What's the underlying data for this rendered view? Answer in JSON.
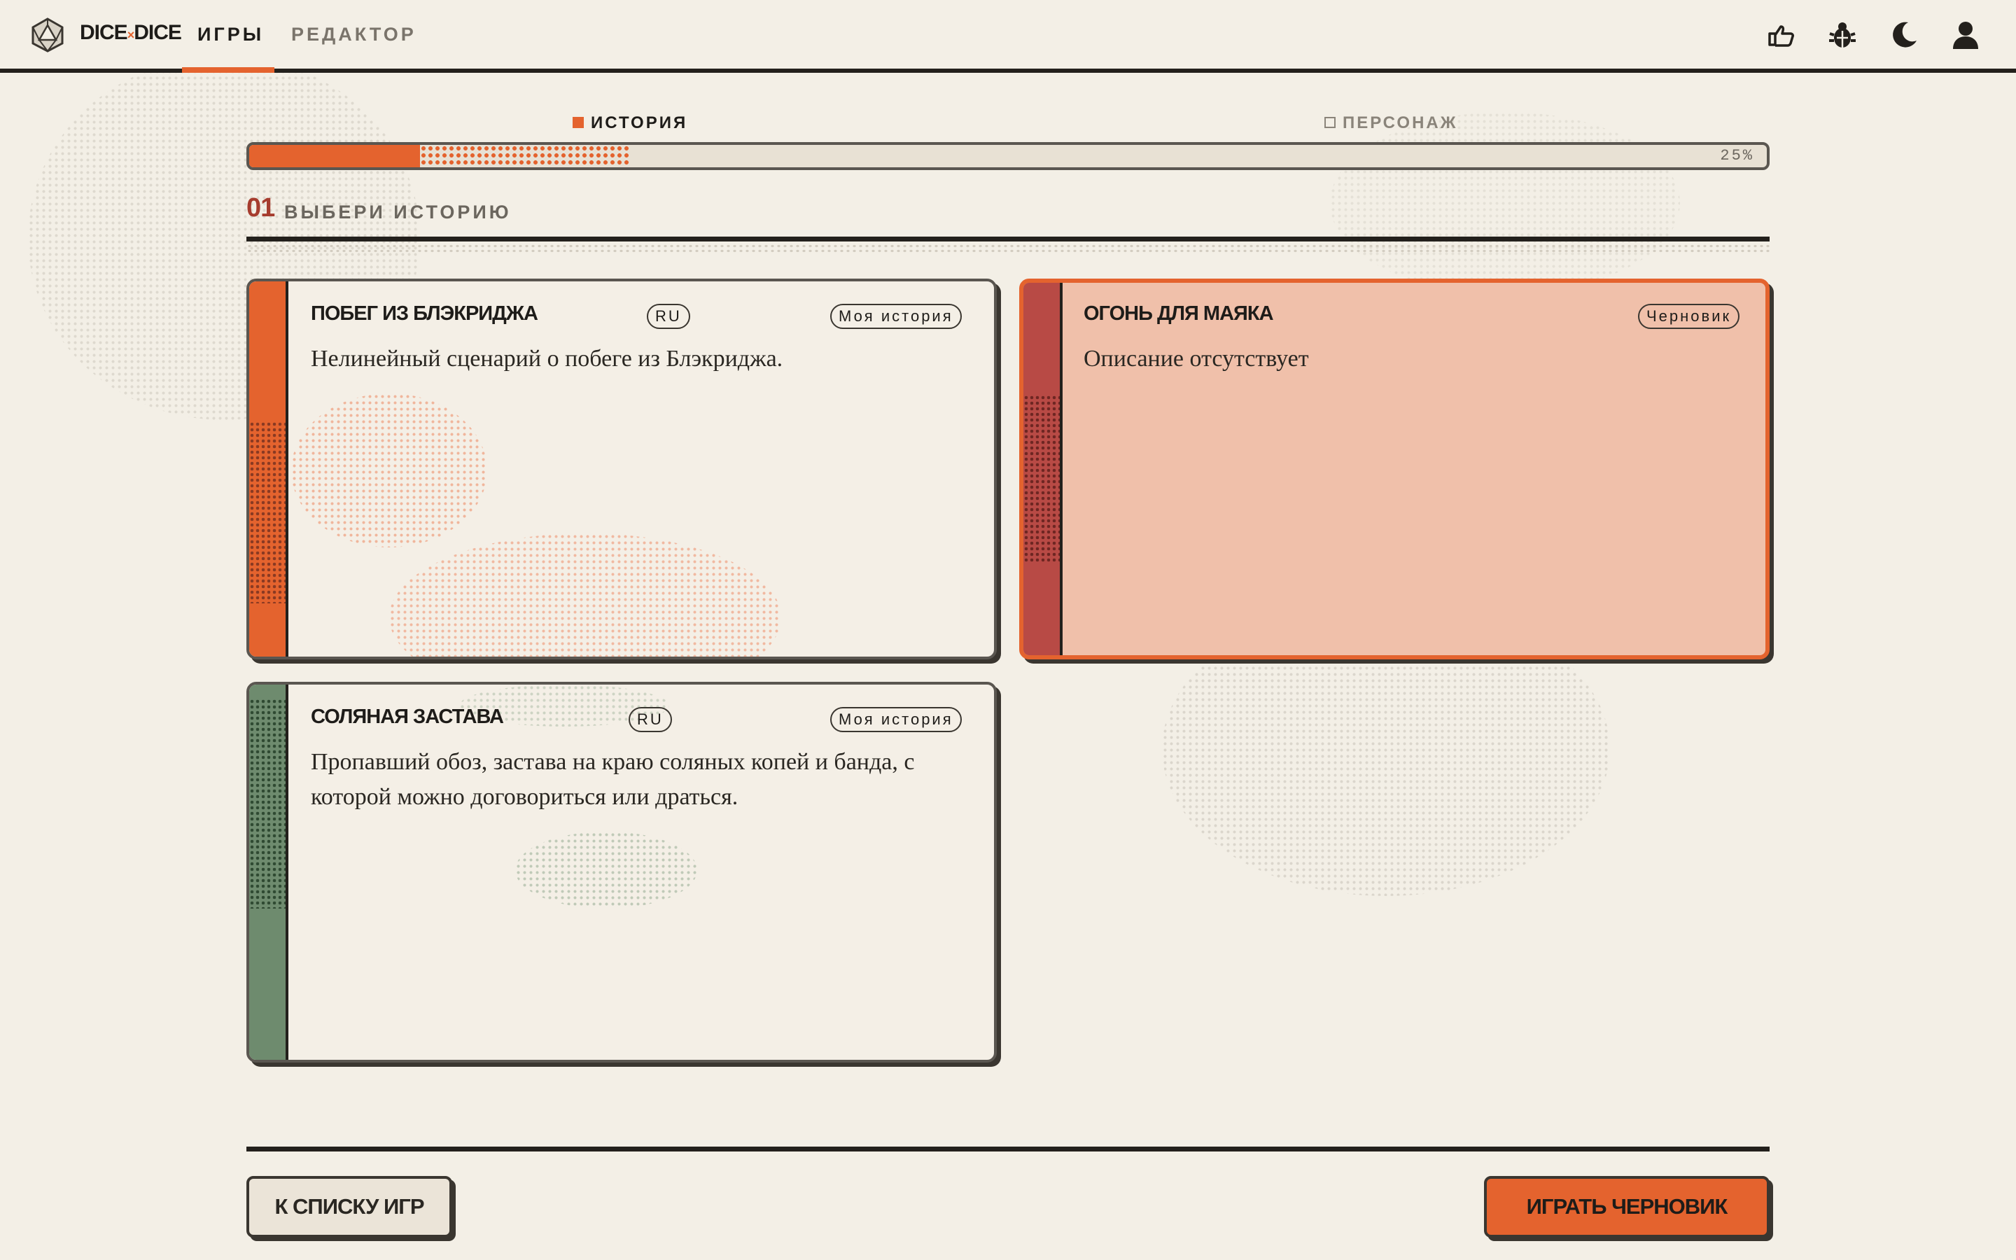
{
  "header": {
    "brand": {
      "left": "DICE",
      "sep": "×",
      "right": "DICE"
    },
    "nav": [
      {
        "label": "ИГРЫ",
        "active": true
      },
      {
        "label": "РЕДАКТОР",
        "active": false
      }
    ],
    "icons": [
      "feedback-icon",
      "bug-icon",
      "theme-moon-icon",
      "user-icon"
    ]
  },
  "stepper": {
    "steps": [
      {
        "label": "ИСТОРИЯ",
        "active": true
      },
      {
        "label": "ПЕРСОНАЖ",
        "active": false
      }
    ],
    "progress_percent": 25,
    "progress_label": "25%"
  },
  "section": {
    "number": "01",
    "title": "ВЫБЕРИ ИСТОРИЮ"
  },
  "cards": [
    {
      "title": "ПОБЕГ ИЗ БЛЭКРИДЖА",
      "lang": "RU",
      "tag": "Моя история",
      "description": "Нелинейный сценарий о побеге из Блэкриджа.",
      "accent": "#e4632e",
      "selected": false
    },
    {
      "title": "ОГОНЬ ДЛЯ МАЯКА",
      "lang": "",
      "tag": "Черновик",
      "description": "Описание отсутствует",
      "accent": "#b84a45",
      "selected": true
    },
    {
      "title": "СОЛЯНАЯ ЗАСТАВА",
      "lang": "RU",
      "tag": "Моя история",
      "description": "Пропавший обоз, застава на краю соляных копей и банда, с которой можно договориться или драться.",
      "accent": "#6e8b6e",
      "selected": false
    }
  ],
  "footer": {
    "back_label": "К СПИСКУ ИГР",
    "play_label": "ИГРАТЬ ЧЕРНОВИК"
  },
  "colors": {
    "background": "#f3efe6",
    "accent": "#e4632e",
    "dark": "#23201c",
    "selected_fill": "#f0c0aa"
  }
}
